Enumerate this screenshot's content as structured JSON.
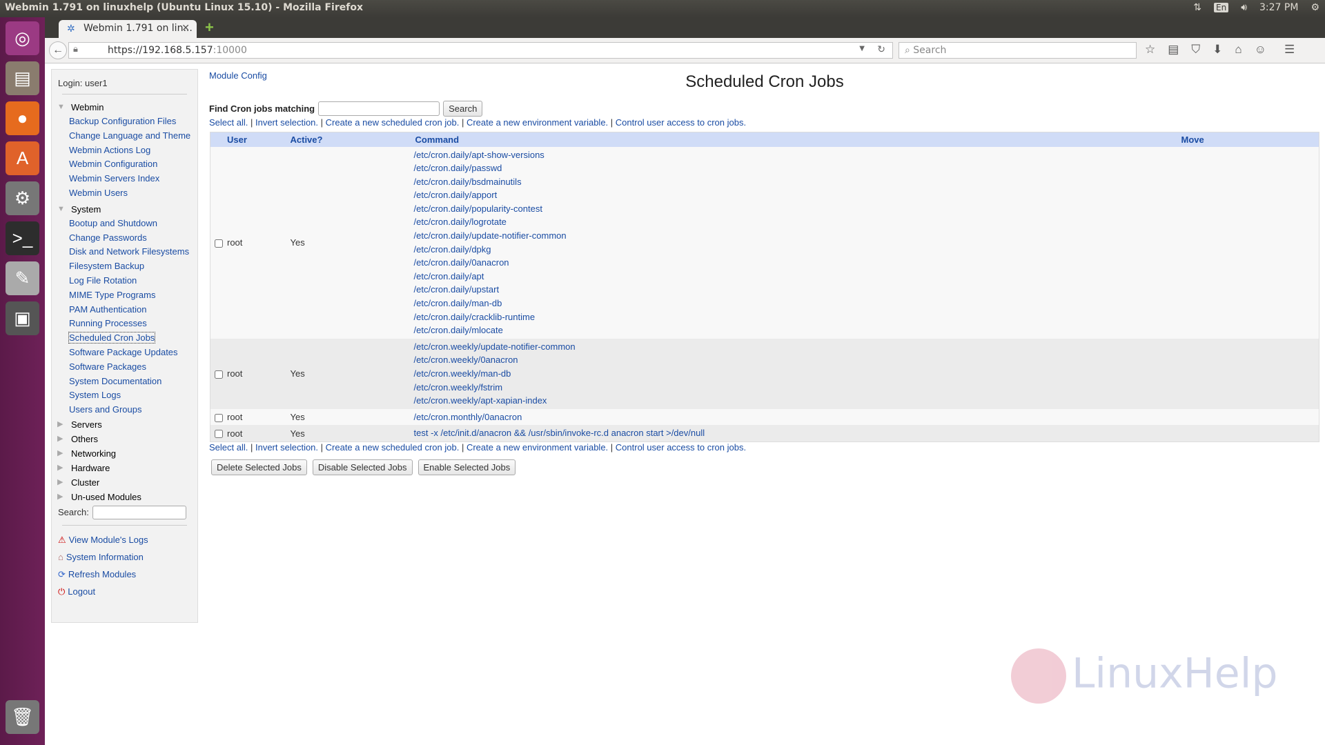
{
  "os": {
    "window_title": "Webmin 1.791 on linuxhelp (Ubuntu Linux 15.10) - Mozilla Firefox",
    "keyboard": "En",
    "time": "3:27 PM"
  },
  "browser": {
    "tab_title": "Webmin 1.791 on lin...",
    "url_host": "https://192.168.5.157",
    "url_port": ":10000",
    "search_placeholder": "Search"
  },
  "sidebar": {
    "login": "Login: user1",
    "categories": [
      {
        "label": "Webmin",
        "expanded": true,
        "items": [
          "Backup Configuration Files",
          "Change Language and Theme",
          "Webmin Actions Log",
          "Webmin Configuration",
          "Webmin Servers Index",
          "Webmin Users"
        ]
      },
      {
        "label": "System",
        "expanded": true,
        "items": [
          "Bootup and Shutdown",
          "Change Passwords",
          "Disk and Network Filesystems",
          "Filesystem Backup",
          "Log File Rotation",
          "MIME Type Programs",
          "PAM Authentication",
          "Running Processes",
          "Scheduled Cron Jobs",
          "Software Package Updates",
          "Software Packages",
          "System Documentation",
          "System Logs",
          "Users and Groups"
        ]
      },
      {
        "label": "Servers",
        "expanded": false,
        "items": []
      },
      {
        "label": "Others",
        "expanded": false,
        "items": []
      },
      {
        "label": "Networking",
        "expanded": false,
        "items": []
      },
      {
        "label": "Hardware",
        "expanded": false,
        "items": []
      },
      {
        "label": "Cluster",
        "expanded": false,
        "items": []
      },
      {
        "label": "Un-used Modules",
        "expanded": false,
        "items": []
      }
    ],
    "selected": "Scheduled Cron Jobs",
    "search_label": "Search:",
    "footer": [
      {
        "label": "View Module's Logs",
        "icon": "warning-icon"
      },
      {
        "label": "System Information",
        "icon": "home-icon"
      },
      {
        "label": "Refresh Modules",
        "icon": "refresh-icon"
      },
      {
        "label": "Logout",
        "icon": "power-icon"
      }
    ]
  },
  "main": {
    "module_config": "Module Config",
    "title": "Scheduled Cron Jobs",
    "find_label": "Find Cron jobs matching",
    "find_value": "",
    "search_button": "Search",
    "links": [
      "Select all.",
      "Invert selection.",
      "Create a new scheduled cron job.",
      "Create a new environment variable.",
      "Control user access to cron jobs."
    ],
    "columns": [
      "User",
      "Active?",
      "Command",
      "Move"
    ],
    "rows": [
      {
        "user": "root",
        "active": "Yes",
        "commands": [
          "/etc/cron.daily/apt-show-versions",
          "/etc/cron.daily/passwd",
          "/etc/cron.daily/bsdmainutils",
          "/etc/cron.daily/apport",
          "/etc/cron.daily/popularity-contest",
          "/etc/cron.daily/logrotate",
          "/etc/cron.daily/update-notifier-common",
          "/etc/cron.daily/dpkg",
          "/etc/cron.daily/0anacron",
          "/etc/cron.daily/apt",
          "/etc/cron.daily/upstart",
          "/etc/cron.daily/man-db",
          "/etc/cron.daily/cracklib-runtime",
          "/etc/cron.daily/mlocate"
        ]
      },
      {
        "user": "root",
        "active": "Yes",
        "commands": [
          "/etc/cron.weekly/update-notifier-common",
          "/etc/cron.weekly/0anacron",
          "/etc/cron.weekly/man-db",
          "/etc/cron.weekly/fstrim",
          "/etc/cron.weekly/apt-xapian-index"
        ]
      },
      {
        "user": "root",
        "active": "Yes",
        "commands": [
          "/etc/cron.monthly/0anacron"
        ]
      },
      {
        "user": "root",
        "active": "Yes",
        "commands": [
          "test -x /etc/init.d/anacron && /usr/sbin/invoke-rc.d anacron start >/dev/null"
        ]
      }
    ],
    "buttons": [
      "Delete Selected Jobs",
      "Disable Selected Jobs",
      "Enable Selected Jobs"
    ]
  },
  "watermark": "LinuxHelp",
  "colors": {
    "link": "#1a4ca3",
    "table_header": "#d0dcf7",
    "launcher": "#5b1a49"
  }
}
